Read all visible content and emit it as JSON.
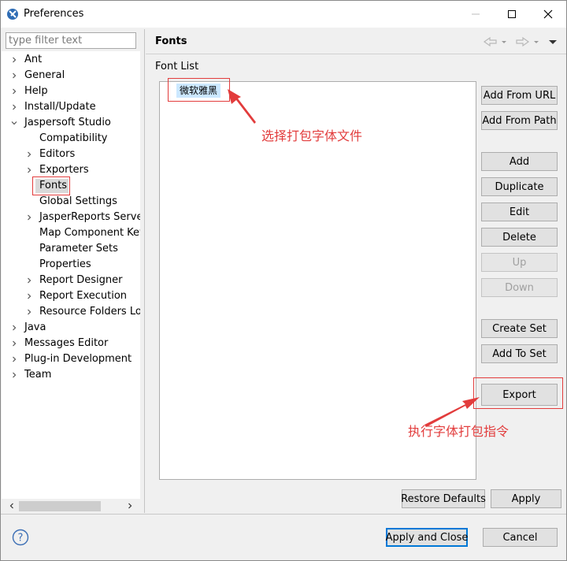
{
  "window": {
    "title": "Preferences"
  },
  "filter": {
    "placeholder": "type filter text"
  },
  "tree": [
    {
      "label": "Ant",
      "expandable": true,
      "expanded": false
    },
    {
      "label": "General",
      "expandable": true,
      "expanded": false
    },
    {
      "label": "Help",
      "expandable": true,
      "expanded": false
    },
    {
      "label": "Install/Update",
      "expandable": true,
      "expanded": false
    },
    {
      "label": "Jaspersoft Studio",
      "expandable": true,
      "expanded": true
    },
    {
      "label": "Compatibility",
      "expandable": false
    },
    {
      "label": "Editors",
      "expandable": true,
      "expanded": false
    },
    {
      "label": "Exporters",
      "expandable": true,
      "expanded": false
    },
    {
      "label": "Fonts",
      "expandable": false,
      "selected": true
    },
    {
      "label": "Global Settings",
      "expandable": false
    },
    {
      "label": "JasperReports Server",
      "expandable": true,
      "expanded": false
    },
    {
      "label": "Map Component Key",
      "expandable": false
    },
    {
      "label": "Parameter Sets",
      "expandable": false
    },
    {
      "label": "Properties",
      "expandable": false
    },
    {
      "label": "Report Designer",
      "expandable": true,
      "expanded": false
    },
    {
      "label": "Report Execution",
      "expandable": true,
      "expanded": false
    },
    {
      "label": "Resource Folders Loc",
      "expandable": true,
      "expanded": false
    },
    {
      "label": "Java",
      "expandable": true,
      "expanded": false
    },
    {
      "label": "Messages Editor",
      "expandable": true,
      "expanded": false
    },
    {
      "label": "Plug-in Development",
      "expandable": true,
      "expanded": false
    },
    {
      "label": "Team",
      "expandable": true,
      "expanded": false
    }
  ],
  "page": {
    "title": "Fonts",
    "section_label": "Font List",
    "font_items": [
      "微软雅黑"
    ]
  },
  "side_buttons": {
    "add_from_url": "Add From URL",
    "add_from_path": "Add From Path",
    "add": "Add",
    "duplicate": "Duplicate",
    "edit": "Edit",
    "delete": "Delete",
    "up": "Up",
    "down": "Down",
    "create_set": "Create Set",
    "add_to_set": "Add To Set",
    "export": "Export"
  },
  "annotations": {
    "select_font": "选择打包字体文件",
    "export_font": "执行字体打包指令"
  },
  "footer": {
    "restore_defaults": "Restore Defaults",
    "apply": "Apply",
    "apply_and_close": "Apply and Close",
    "cancel": "Cancel"
  },
  "colors": {
    "annotation": "#e23c3c",
    "selection": "#cce8ff",
    "focus": "#0078d7"
  }
}
